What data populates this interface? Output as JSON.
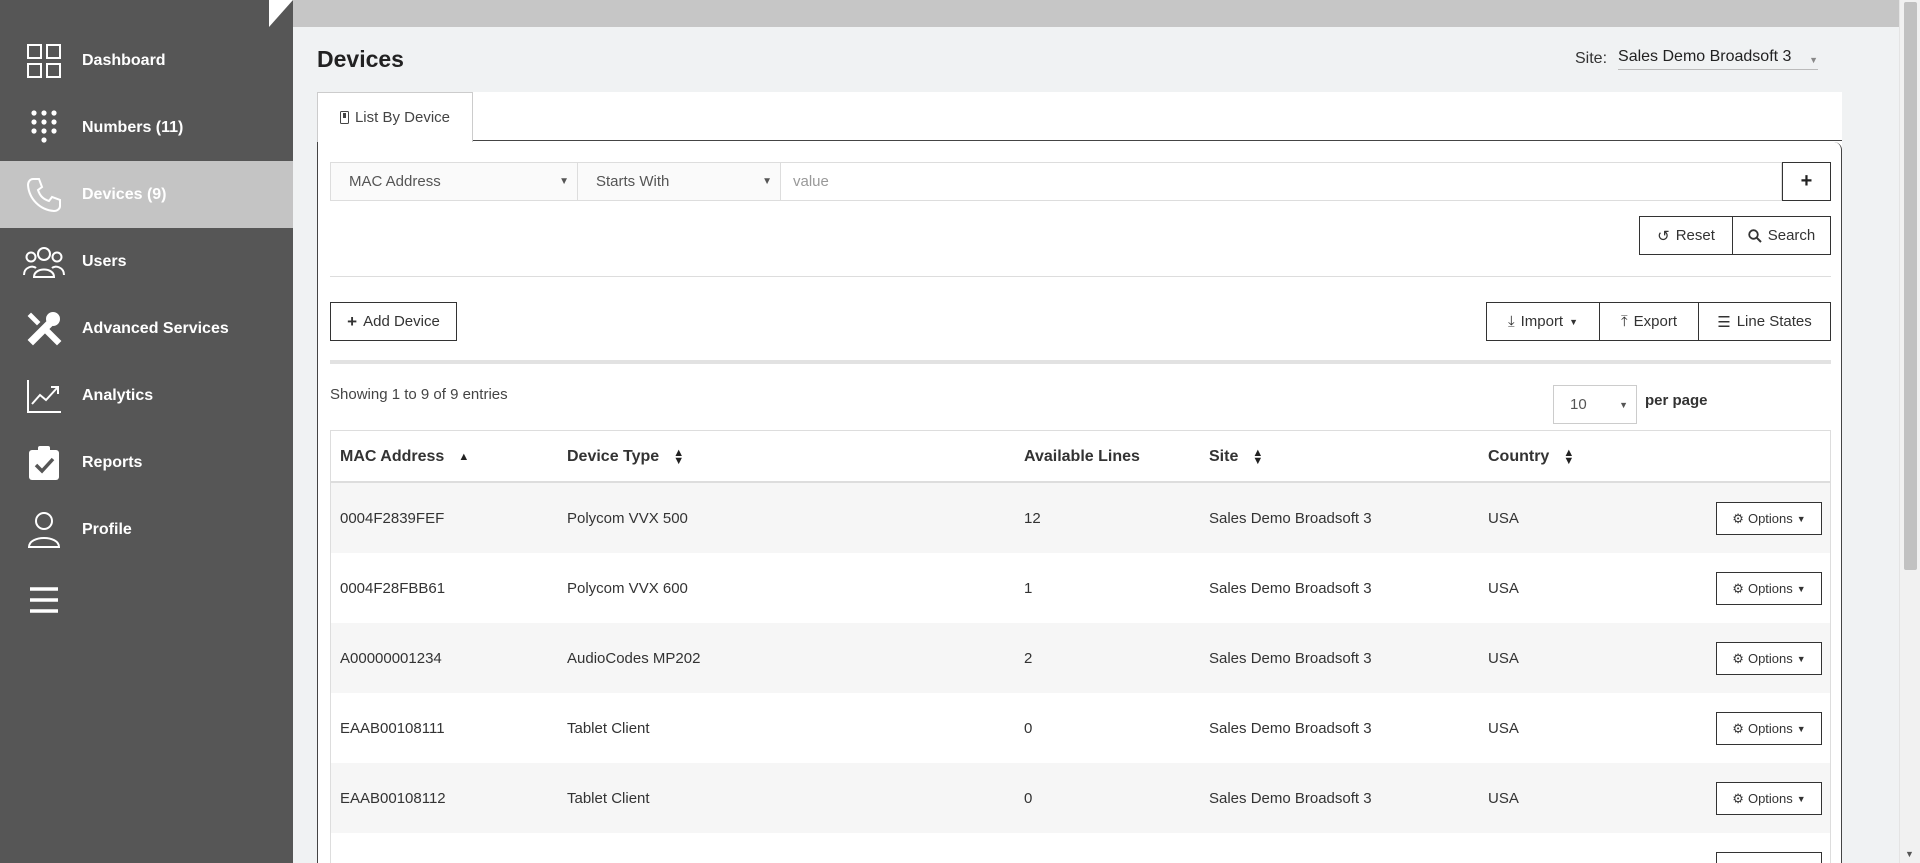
{
  "sidebar": {
    "items": [
      {
        "label": "Dashboard",
        "icon": "dashboard-grid-icon",
        "active": false
      },
      {
        "label": "Numbers (11)",
        "icon": "keypad-icon",
        "active": false
      },
      {
        "label": "Devices (9)",
        "icon": "phone-handset-icon",
        "active": true
      },
      {
        "label": "Users",
        "icon": "users-group-icon",
        "active": false
      },
      {
        "label": "Advanced Services",
        "icon": "tools-icon",
        "active": false
      },
      {
        "label": "Analytics",
        "icon": "chart-line-icon",
        "active": false
      },
      {
        "label": "Reports",
        "icon": "clipboard-check-icon",
        "active": false
      },
      {
        "label": "Profile",
        "icon": "user-profile-icon",
        "active": false
      }
    ],
    "menu_icon": "hamburger-menu-icon"
  },
  "header": {
    "title": "Devices",
    "site_label": "Site:",
    "site_value": "Sales Demo Broadsoft 3"
  },
  "tabs": [
    {
      "label": "List By Device",
      "icon": "phone-small-icon"
    }
  ],
  "filter": {
    "field": "MAC Address",
    "operator": "Starts With",
    "value_placeholder": "value",
    "add_label": "+"
  },
  "actions": {
    "reset_label": "Reset",
    "search_label": "Search",
    "add_device_label": "Add Device",
    "import_label": "Import",
    "export_label": "Export",
    "line_states_label": "Line States"
  },
  "listing": {
    "showing_text": "Showing 1 to 9 of 9 entries",
    "per_page_value": "10",
    "per_page_label": "per page"
  },
  "table": {
    "columns": [
      "MAC Address",
      "Device Type",
      "Available Lines",
      "Site",
      "Country"
    ],
    "rows": [
      {
        "mac": "0004F2839FEF",
        "type": "Polycom VVX 500",
        "lines": "12",
        "site": "Sales Demo Broadsoft 3",
        "country": "USA",
        "options": "Options"
      },
      {
        "mac": "0004F28FBB61",
        "type": "Polycom VVX 600",
        "lines": "1",
        "site": "Sales Demo Broadsoft 3",
        "country": "USA",
        "options": "Options"
      },
      {
        "mac": "A00000001234",
        "type": "AudioCodes MP202",
        "lines": "2",
        "site": "Sales Demo Broadsoft 3",
        "country": "USA",
        "options": "Options"
      },
      {
        "mac": "EAAB00108111",
        "type": "Tablet Client",
        "lines": "0",
        "site": "Sales Demo Broadsoft 3",
        "country": "USA",
        "options": "Options"
      },
      {
        "mac": "EAAB00108112",
        "type": "Tablet Client",
        "lines": "0",
        "site": "Sales Demo Broadsoft 3",
        "country": "USA",
        "options": "Options"
      }
    ]
  }
}
